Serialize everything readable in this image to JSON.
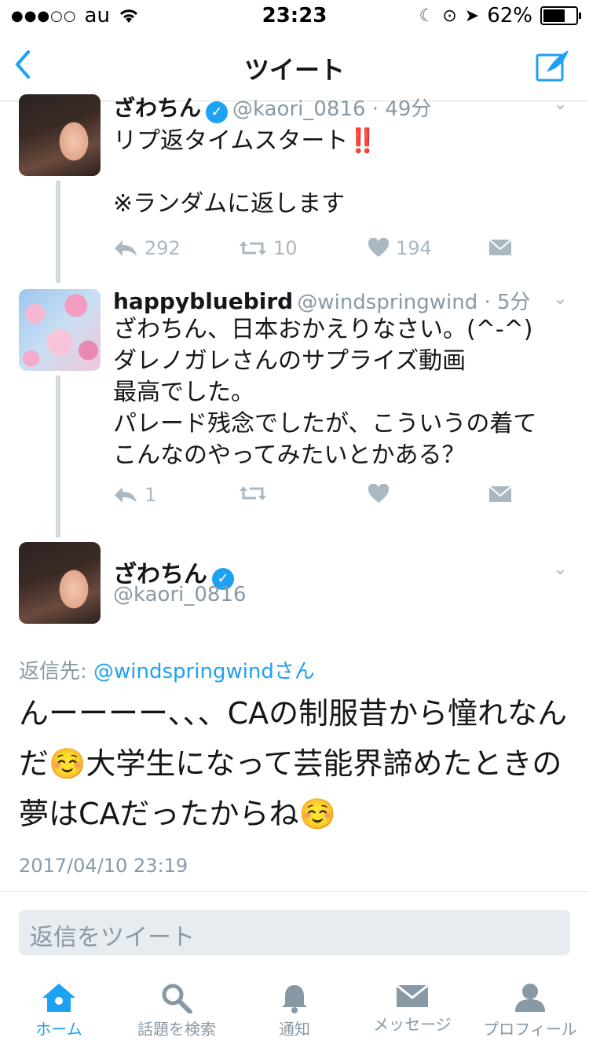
{
  "status": {
    "carrier": "au",
    "time": "23:23",
    "battery": "62%"
  },
  "nav": {
    "title": "ツイート"
  },
  "tweets": [
    {
      "name": "ざわちん",
      "handle": "@kaori_0816 · 49分",
      "text": "リプ返タイムスタート‼️\n\n※ランダムに返します",
      "replies": "292",
      "retweets": "10",
      "likes": "194"
    },
    {
      "name": "happybluebird",
      "handle": "@windspringwind · 5分",
      "text": "ざわちん、日本おかえりなさい。(^-^)\nダレノガレさんのサプライズ動画\n最高でした。\nパレード残念でしたが、こういうの着て\nこんなのやってみたいとかある？",
      "replies": "1"
    }
  ],
  "main": {
    "name": "ざわちん",
    "handle": "@kaori_0816",
    "reply_prefix": "返信先: ",
    "reply_link": "@windspringwindさん",
    "text": "んーーーー、、、CAの制服昔から憧れなんだ☺️大学生になって芸能界諦めたときの夢はCAだったからね☺️",
    "date": "2017/04/10 23:19"
  },
  "reply_box": {
    "placeholder": "返信をツイート"
  },
  "tabs": [
    {
      "label": "ホーム",
      "icon": "home-icon"
    },
    {
      "label": "話題を検索",
      "icon": "search-icon"
    },
    {
      "label": "通知",
      "icon": "bell-icon"
    },
    {
      "label": "メッセージ",
      "icon": "envelope-icon"
    },
    {
      "label": "プロフィール",
      "icon": "profile-icon"
    }
  ],
  "colors": {
    "accent": "#1da1f2",
    "muted": "#8899a6",
    "icon_gray": "#aab8c2"
  }
}
